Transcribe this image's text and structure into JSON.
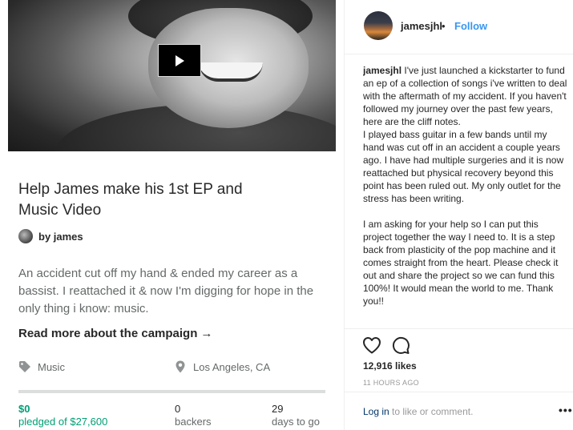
{
  "campaign": {
    "title": "Help James make his 1st EP and Music Video",
    "creator": "by james",
    "blurb": "An accident cut off my hand & ended my career as a bassist. I reattached it & now I'm digging for hope in the only thing i know: music.",
    "read_more": "Read more about the campaign",
    "read_more_arrow": "→",
    "category": "Music",
    "location": "Los Angeles, CA",
    "funded_fraction": 0,
    "pledged_amount": "$0",
    "pledged_label": "pledged of $27,600",
    "backers_count": "0",
    "backers_label": "backers",
    "days_count": "29",
    "days_label": "days to go",
    "accent_color": "#009e74"
  },
  "instagram": {
    "username": "jamesjhl",
    "dot": "•",
    "follow_label": "Follow",
    "caption_user": "jamesjhl",
    "caption_text": " I've just launched a kickstarter to fund an ep of a collection of songs i've written to deal with the aftermath of my accident. If you haven't followed my journey over the past few years, here are the cliff notes.\nI played bass guitar in a few bands until my hand was cut off in an accident a couple years ago. I have had multiple surgeries and it is now reattached but physical recovery beyond this point has been ruled out. My only outlet for the stress has been writing.\n\nI am asking for your help so I can put this project together the way I need to. It is a step back from plasticity of the pop machine and it comes straight from the heart. Please check it out and share the project so we can fund this 100%! It would mean the world to me. Thank you!!",
    "likes": "12,916 likes",
    "time": "11 HOURS AGO",
    "login_link": "Log in",
    "login_rest": " to like or comment.",
    "more": "•••",
    "follow_color": "#3897f0"
  },
  "icons": {
    "play": "play-icon",
    "tag": "tag-icon",
    "pin": "location-pin-icon",
    "heart": "heart-icon",
    "comment": "comment-icon"
  }
}
